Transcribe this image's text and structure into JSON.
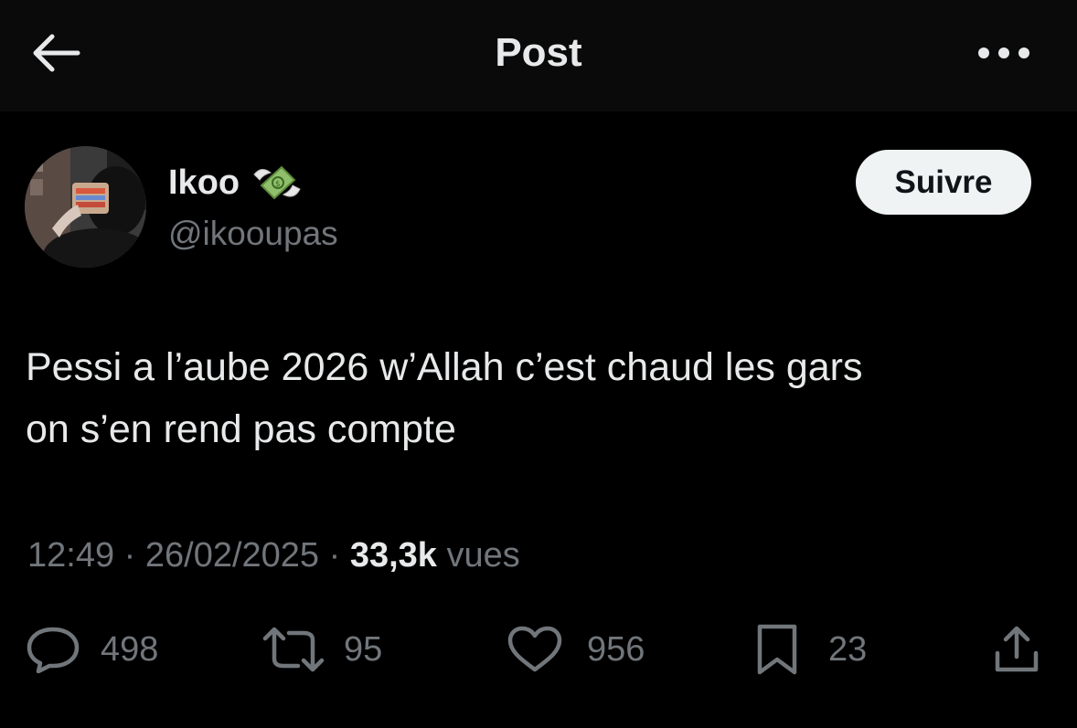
{
  "header": {
    "title": "Post",
    "back_icon": "arrow-left-icon",
    "more_icon": "more-horizontal-icon"
  },
  "author": {
    "display_name": "Ikoo",
    "name_emoji": "money-with-wings-emoji",
    "handle": "@ikooupas",
    "follow_label": "Suivre"
  },
  "tweet": {
    "text_line1": "Pessi a l’aube 2026 w’Allah c’est chaud les gars",
    "text_line2": "on s’en rend pas compte",
    "time": "12:49",
    "sep1": " · ",
    "date": "26/02/2025",
    "sep2": " · ",
    "views_count": "33,3k",
    "views_label": " vues"
  },
  "actions": {
    "replies": "498",
    "reposts": "95",
    "likes": "956",
    "bookmarks": "23"
  },
  "colors": {
    "background": "#000000",
    "header_bg": "#0a0a0a",
    "text_primary": "#e7e9ea",
    "text_secondary": "#71767b",
    "follow_bg": "#eff3f4"
  }
}
